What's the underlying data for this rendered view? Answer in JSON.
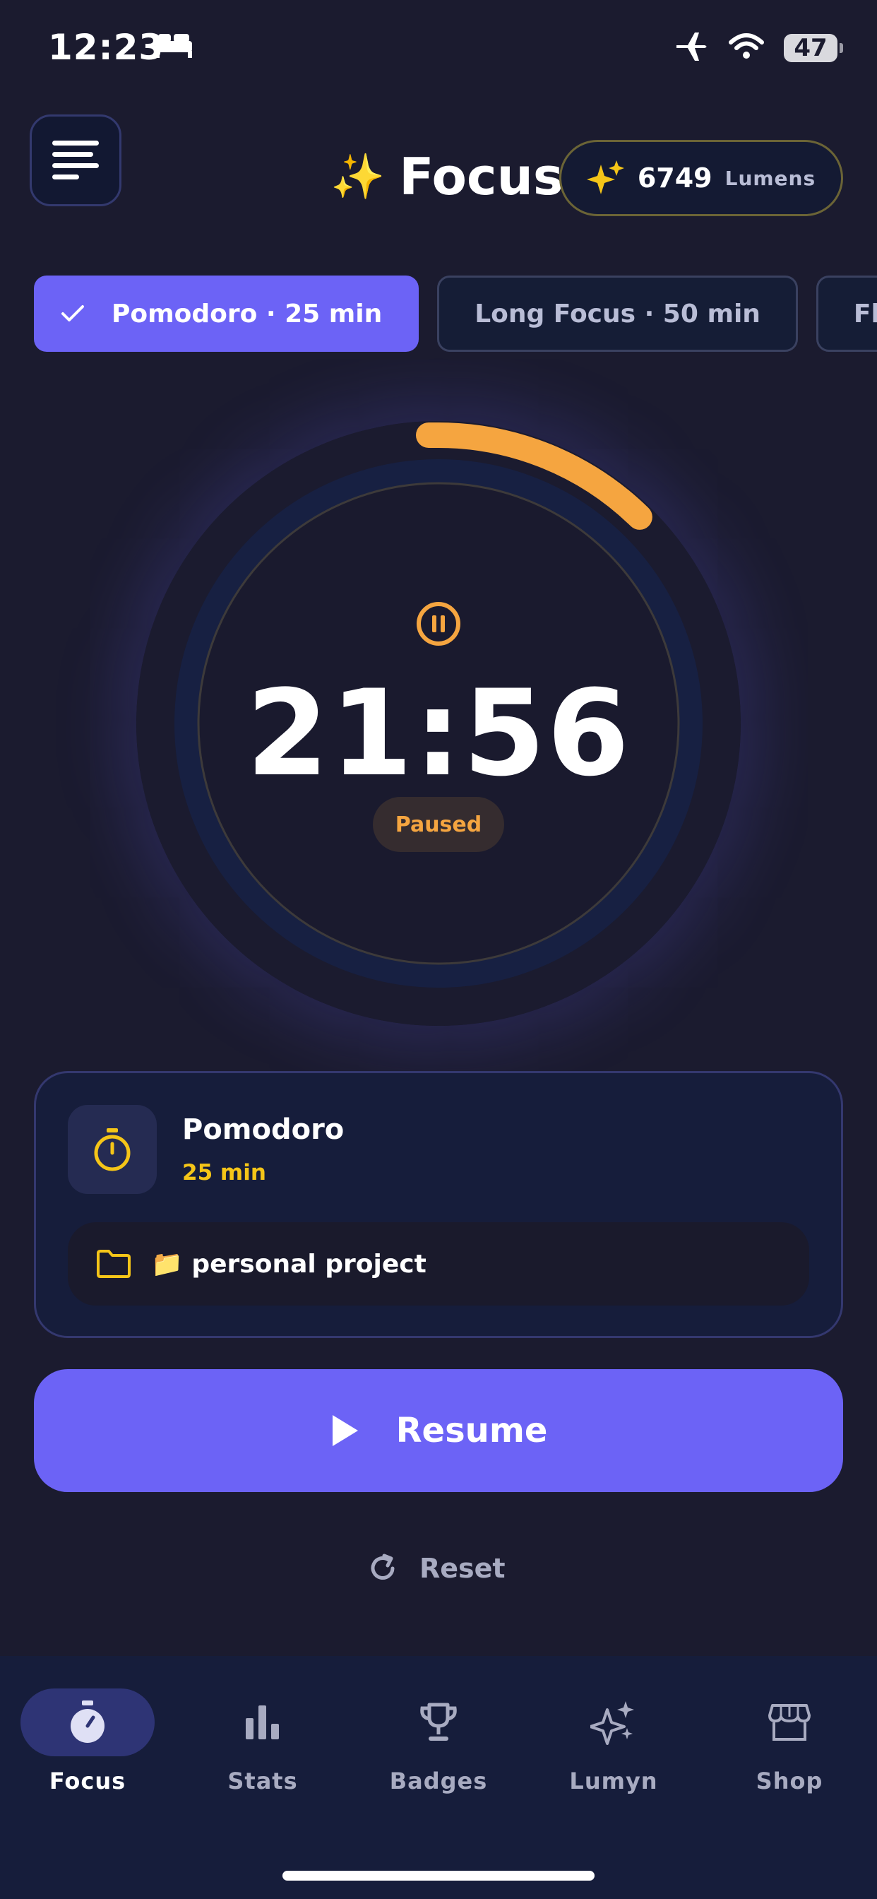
{
  "status_bar": {
    "time": "12:23",
    "battery": "47",
    "icons": [
      "bed-icon",
      "airplane-icon",
      "wifi-icon",
      "battery-icon"
    ]
  },
  "header": {
    "title": "Focus",
    "title_emoji": "✨",
    "lumens_value": "6749",
    "lumens_unit": "Lumens"
  },
  "modes": [
    {
      "label": "Pomodoro · 25 min",
      "selected": true
    },
    {
      "label": "Long Focus · 50 min",
      "selected": false
    },
    {
      "label": "Flow",
      "selected": false
    }
  ],
  "timer": {
    "time": "21:56",
    "state": "Paused",
    "progress_fraction": 0.123
  },
  "session": {
    "title": "Pomodoro",
    "duration": "25 min",
    "project": "📁 personal project"
  },
  "actions": {
    "resume": "Resume",
    "reset": "Reset"
  },
  "tabs": [
    {
      "label": "Focus",
      "icon": "stopwatch-icon",
      "active": true
    },
    {
      "label": "Stats",
      "icon": "bar-chart-icon",
      "active": false
    },
    {
      "label": "Badges",
      "icon": "trophy-icon",
      "active": false
    },
    {
      "label": "Lumyn",
      "icon": "sparkles-icon",
      "active": false
    },
    {
      "label": "Shop",
      "icon": "store-icon",
      "active": false
    }
  ],
  "colors": {
    "background": "#1b1b2f",
    "accent": "#6c63f6",
    "progress": "#f5a540",
    "gold": "#f5c518"
  }
}
